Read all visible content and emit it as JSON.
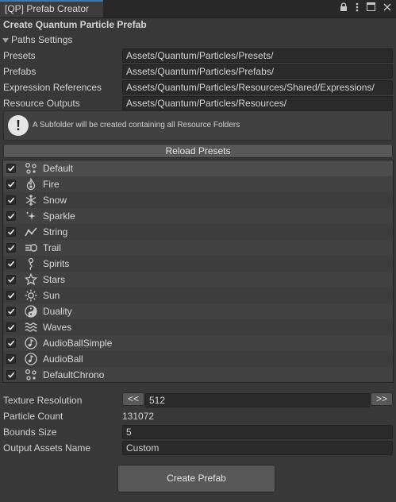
{
  "window": {
    "tab_title": "[QP] Prefab Creator"
  },
  "header": {
    "title": "Create Quantum Particle Prefab"
  },
  "paths": {
    "foldout_label": "Paths Settings",
    "rows": [
      {
        "label": "Presets",
        "value": "Assets/Quantum/Particles/Presets/"
      },
      {
        "label": "Prefabs",
        "value": "Assets/Quantum/Particles/Prefabs/"
      },
      {
        "label": "Expression References",
        "value": "Assets/Quantum/Particles/Resources/Shared/Expressions/"
      },
      {
        "label": "Resource Outputs",
        "value": "Assets/Quantum/Particles/Resources/"
      }
    ]
  },
  "help": {
    "icon_text": "!",
    "message": "A Subfolder will be created containing all Resource Folders"
  },
  "reload_button": "Reload Presets",
  "presets": [
    {
      "name": "Default",
      "icon": "particles-icon",
      "checked": true
    },
    {
      "name": "Fire",
      "icon": "fire-icon",
      "checked": true
    },
    {
      "name": "Snow",
      "icon": "snowflake-icon",
      "checked": true
    },
    {
      "name": "Sparkle",
      "icon": "sparkle-icon",
      "checked": true
    },
    {
      "name": "String",
      "icon": "line-graph-icon",
      "checked": true
    },
    {
      "name": "Trail",
      "icon": "trail-icon",
      "checked": true
    },
    {
      "name": "Spirits",
      "icon": "spirit-icon",
      "checked": true
    },
    {
      "name": "Stars",
      "icon": "star-icon",
      "checked": true
    },
    {
      "name": "Sun",
      "icon": "sun-icon",
      "checked": true
    },
    {
      "name": "Duality",
      "icon": "yin-yang-icon",
      "checked": true
    },
    {
      "name": "Waves",
      "icon": "waves-icon",
      "checked": true
    },
    {
      "name": "AudioBallSimple",
      "icon": "music-note-circle-icon",
      "checked": true
    },
    {
      "name": "AudioBall",
      "icon": "music-note-circle-icon",
      "checked": true
    },
    {
      "name": "DefaultChrono",
      "icon": "particles-icon",
      "checked": true
    }
  ],
  "settings": {
    "texture_resolution": {
      "label": "Texture Resolution",
      "value": "512",
      "prev": "<<",
      "next": ">>"
    },
    "particle_count": {
      "label": "Particle Count",
      "value": "131072"
    },
    "bounds_size": {
      "label": "Bounds Size",
      "value": "5"
    },
    "output_name": {
      "label": "Output Assets Name",
      "value": "Custom"
    }
  },
  "create_button": "Create Prefab"
}
